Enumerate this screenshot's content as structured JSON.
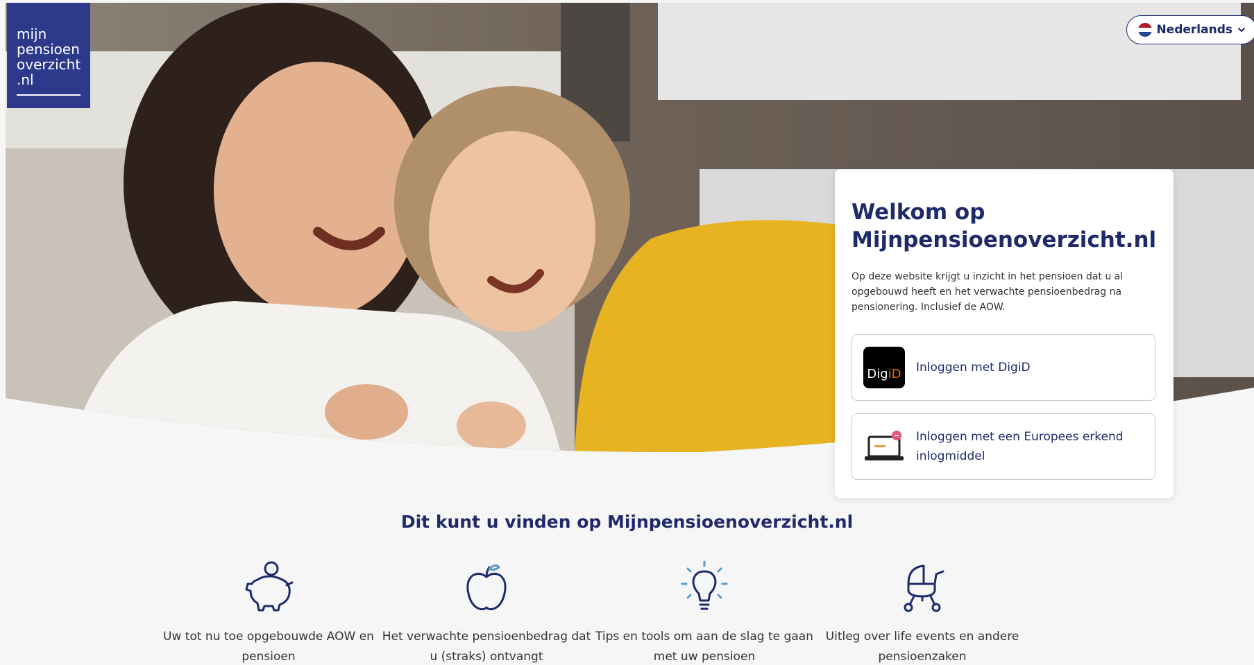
{
  "logo": {
    "line1": "mijn",
    "line2": "pensioen",
    "line3": "overzicht",
    "line4": ".nl"
  },
  "language": {
    "selected": "Nederlands",
    "flag_colors": [
      "#ae1c28",
      "#ffffff",
      "#21468b"
    ]
  },
  "welcome": {
    "title": "Welkom op Mijnpensioenoverzicht.nl",
    "intro": "Op deze website krijgt u inzicht in het pensioen dat u al opgebouwd heeft en het verwachte pensioenbedrag na pensionering. Inclusief de AOW.",
    "login_digid": "Inloggen met DigiD",
    "digid_logo_prefix": "Dig",
    "digid_logo_suffix": "iD",
    "login_eu": "Inloggen met een Europees erkend inlogmiddel"
  },
  "section": {
    "title": "Dit kunt u vinden op Mijnpensioenoverzicht.nl",
    "features": [
      {
        "icon": "piggy-bank-icon",
        "text": "Uw tot nu toe opgebouwde AOW en pensioen"
      },
      {
        "icon": "apple-icon",
        "text": "Het verwachte pensioenbedrag dat u (straks) ontvangt"
      },
      {
        "icon": "lightbulb-icon",
        "text": "Tips en tools om aan de slag te gaan met uw pensioen"
      },
      {
        "icon": "stroller-icon",
        "text": "Uitleg over life events en andere pensioenzaken"
      }
    ]
  },
  "colors": {
    "brand": "#2d3a8c",
    "heading": "#1f2a6b",
    "digid_accent": "#e17000"
  }
}
